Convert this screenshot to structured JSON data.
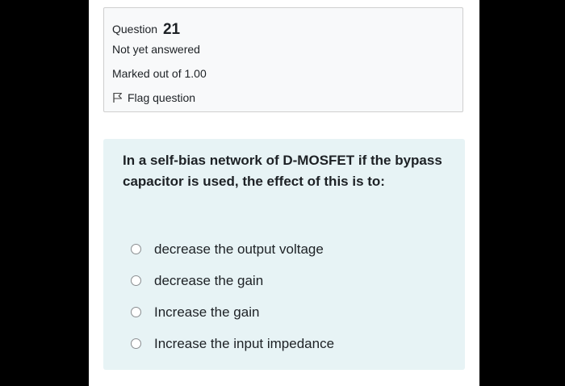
{
  "info": {
    "question_label": "Question",
    "question_number": "21",
    "status": "Not yet answered",
    "marks": "Marked out of 1.00",
    "flag_label": "Flag question",
    "flag_icon": "flag-icon"
  },
  "question": {
    "text": "In a self-bias network of D-MOSFET if the bypass capacitor is used, the effect of this is to:",
    "answers": [
      "decrease the output voltage",
      "decrease the gain",
      "Increase the gain",
      "Increase the input impedance"
    ]
  },
  "colors": {
    "background": "#000000",
    "info_box_bg": "#f8f9fa",
    "content_box_bg": "#e7f3f5",
    "text": "#1d2125"
  }
}
